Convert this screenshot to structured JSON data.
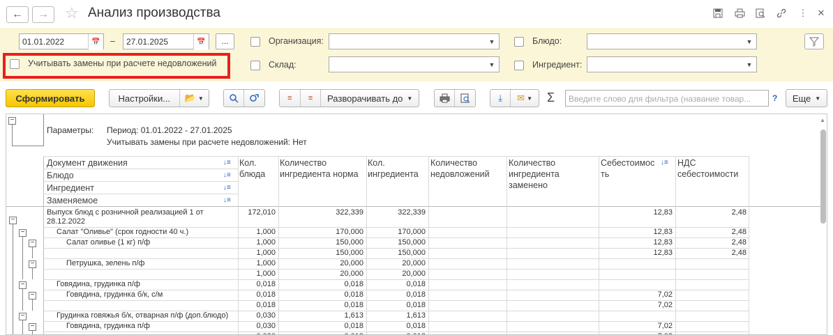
{
  "window": {
    "title": "Анализ производства"
  },
  "filters": {
    "date_from": "01.01.2022",
    "date_sep": "–",
    "date_to": "27.01.2025",
    "period_btn": "...",
    "organization_label": "Организация:",
    "warehouse_label": "Склад:",
    "dish_label": "Блюдо:",
    "ingredient_label": "Ингредиент:",
    "replacement_label": "Учитывать замены при расчете недовложений",
    "highlight_color": "#e8201c"
  },
  "toolbar": {
    "generate": "Сформировать",
    "settings": "Настройки...",
    "expand_to": "Разворачивать до",
    "search_placeholder": "Введите слово для фильтра (название товар...",
    "help": "?",
    "more": "Еще",
    "sigma": "Σ"
  },
  "report": {
    "params_label": "Параметры:",
    "period_line": "Период: 01.01.2022 - 27.01.2025",
    "replacement_line": "Учитывать замены при расчете недовложений: Нет",
    "group_headers": [
      "Документ движения",
      "Блюдо",
      "Ингредиент",
      "Заменяемое"
    ],
    "columns": {
      "kol_bluda": "Кол. блюда",
      "kol_ingr_norma": "Количество ингредиента норма",
      "kol_ingr": "Кол. ингредиента",
      "kol_nedovl": "Количество недовложений",
      "kol_zameneno": "Количество ингредиента заменено",
      "sebest": "Себестоимос ть",
      "nds": "НДС себестоимости"
    },
    "rows": [
      {
        "name": "Выпуск блюд с розничной реализацией 1 от",
        "name2": "28.12.2022",
        "a": "172,010",
        "b": "322,339",
        "c": "322,339",
        "s": "12,83",
        "n": "2,48"
      },
      {
        "name": "Салат \"Оливье\" (срок годности 40 ч.)",
        "a": "1,000",
        "b": "170,000",
        "c": "170,000",
        "s": "12,83",
        "n": "2,48"
      },
      {
        "name": "Салат оливье (1 кг) п/ф",
        "a": "1,000",
        "b": "150,000",
        "c": "150,000",
        "s": "12,83",
        "n": "2,48"
      },
      {
        "name": "",
        "a": "1,000",
        "b": "150,000",
        "c": "150,000",
        "s": "12,83",
        "n": "2,48"
      },
      {
        "name": "Петрушка, зелень п/ф",
        "a": "1,000",
        "b": "20,000",
        "c": "20,000",
        "s": "",
        "n": ""
      },
      {
        "name": "",
        "a": "1,000",
        "b": "20,000",
        "c": "20,000",
        "s": "",
        "n": ""
      },
      {
        "name": "Говядина, грудинка п/ф",
        "a": "0,018",
        "b": "0,018",
        "c": "0,018",
        "s": "",
        "n": ""
      },
      {
        "name": "Говядина, грудинка б/к, с/м",
        "a": "0,018",
        "b": "0,018",
        "c": "0,018",
        "s": "7,02",
        "n": ""
      },
      {
        "name": "",
        "a": "0,018",
        "b": "0,018",
        "c": "0,018",
        "s": "7,02",
        "n": ""
      },
      {
        "name": "Грудинка говяжья б/к, отварная п/ф (доп.блюдо)",
        "a": "0,030",
        "b": "1,613",
        "c": "1,613",
        "s": "",
        "n": ""
      },
      {
        "name": "Говядина, грудинка п/ф",
        "a": "0,030",
        "b": "0,018",
        "c": "0,018",
        "s": "7,02",
        "n": ""
      },
      {
        "name": "",
        "a": "0,030",
        "b": "0,018",
        "c": "0,018",
        "s": "7,02",
        "n": ""
      }
    ]
  }
}
